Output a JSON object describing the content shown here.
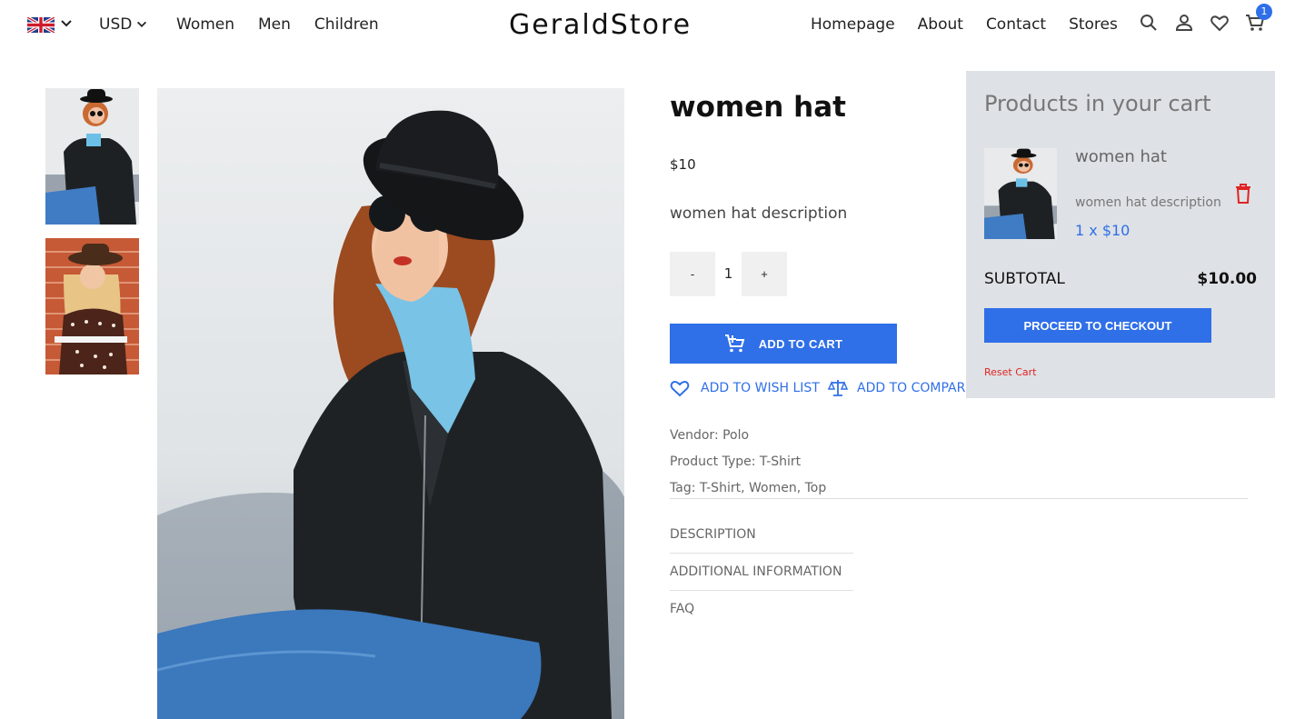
{
  "header": {
    "currency": "USD",
    "nav_left": [
      "Women",
      "Men",
      "Children"
    ],
    "logo": "GeraldStore",
    "nav_right": [
      "Homepage",
      "About",
      "Contact",
      "Stores"
    ],
    "cart_count": "1"
  },
  "product": {
    "title": "women hat",
    "price": "$10",
    "description": "women hat description",
    "qty_minus": "-",
    "qty_value": "1",
    "qty_plus": "+",
    "add_to_cart": "ADD TO CART",
    "wish_list": "ADD TO WISH LIST",
    "compare": "ADD TO COMPARE",
    "vendor": "Vendor: Polo",
    "type": "Product Type: T-Shirt",
    "tags": "Tag: T-Shirt, Women, Top",
    "tabs": [
      "DESCRIPTION",
      "ADDITIONAL INFORMATION",
      "FAQ"
    ]
  },
  "cart": {
    "heading": "Products in your cart",
    "item_name": "women hat",
    "item_desc": "women hat description",
    "item_qty": "1 x $10",
    "subtotal_label": "SUBTOTAL",
    "subtotal_value": "$10.00",
    "checkout": "PROCEED TO CHECKOUT",
    "reset": "Reset Cart"
  },
  "colors": {
    "accent": "#2f6fe8",
    "cart_bg": "#dee1e5",
    "danger": "#e02424"
  }
}
